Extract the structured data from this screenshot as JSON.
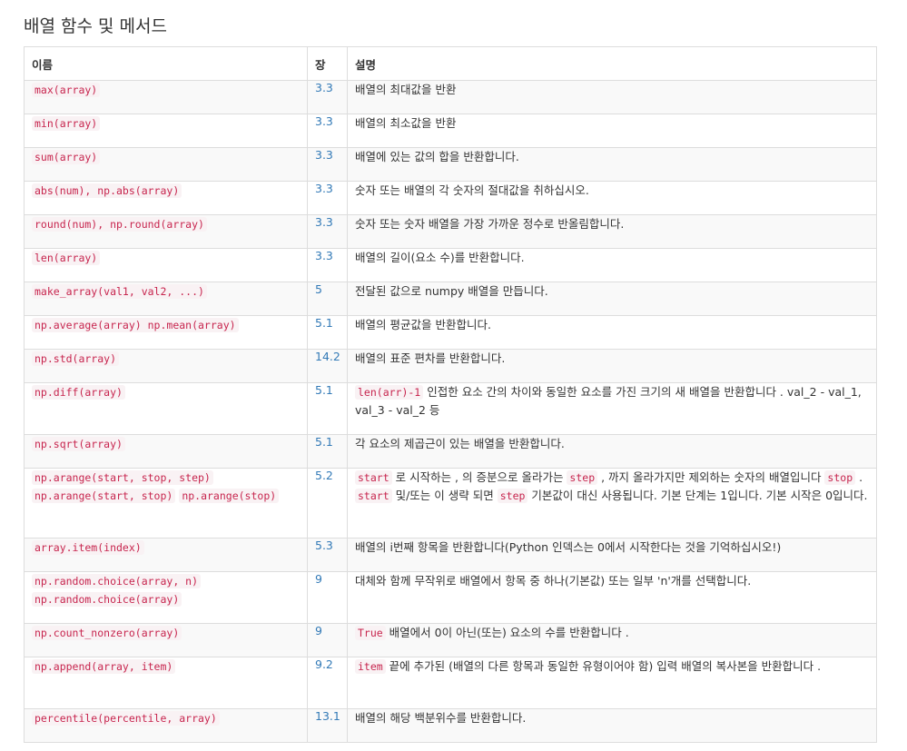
{
  "title": "배열 함수 및 메서드",
  "headers": {
    "name": "이름",
    "chapter": "장",
    "description": "설명"
  },
  "rows": [
    {
      "name": [
        "max(array)"
      ],
      "chapter": "3.3",
      "desc": [
        {
          "t": "배열의 최대값을 반환"
        }
      ]
    },
    {
      "name": [
        "min(array)"
      ],
      "chapter": "3.3",
      "desc": [
        {
          "t": "배열의 최소값을 반환"
        }
      ]
    },
    {
      "name": [
        "sum(array)"
      ],
      "chapter": "3.3",
      "desc": [
        {
          "t": "배열에 있는 값의 합을 반환합니다."
        }
      ]
    },
    {
      "name": [
        "abs(num), np.abs(array)"
      ],
      "chapter": "3.3",
      "desc": [
        {
          "t": "숫자 또는 배열의 각 숫자의 절대값을 취하십시오."
        }
      ]
    },
    {
      "name": [
        "round(num), np.round(array)"
      ],
      "chapter": "3.3",
      "desc": [
        {
          "t": "숫자 또는 숫자 배열을 가장 가까운 정수로 반올림합니다."
        }
      ]
    },
    {
      "name": [
        "len(array)"
      ],
      "chapter": "3.3",
      "desc": [
        {
          "t": "배열의 길이(요소 수)를 반환합니다."
        }
      ]
    },
    {
      "name": [
        "make_array(val1, val2, ...)"
      ],
      "chapter": "5",
      "desc": [
        {
          "t": "전달된 값으로 numpy 배열을 만듭니다."
        }
      ]
    },
    {
      "name": [
        "np.average(array) np.mean(array)"
      ],
      "chapter": "5.1",
      "desc": [
        {
          "t": "배열의 평균값을 반환합니다."
        }
      ]
    },
    {
      "name": [
        "np.std(array)"
      ],
      "chapter": "14.2",
      "desc": [
        {
          "t": "배열의 표준 편차를 반환합니다."
        }
      ]
    },
    {
      "name": [
        "np.diff(array)"
      ],
      "chapter": "5.1",
      "desc": [
        {
          "c": "len(arr)-1"
        },
        {
          "t": " 인접한 요소 간의 차이와 동일한 요소를 가진 크기의 새 배열을 반환합니다 . val_2 - val_1, val_3 - val_2 등"
        }
      ]
    },
    {
      "name": [
        "np.sqrt(array)"
      ],
      "chapter": "5.1",
      "desc": [
        {
          "t": "각 요소의 제곱근이 있는 배열을 반환합니다."
        }
      ]
    },
    {
      "name": [
        "np.arange(start, stop, step)",
        "np.arange(start, stop)",
        "np.arange(stop)"
      ],
      "chapter": "5.2",
      "desc": [
        {
          "c": "start"
        },
        {
          "t": " 로 시작하는 , 의 증분으로 올라가는 "
        },
        {
          "c": "step"
        },
        {
          "t": " , 까지 올라가지만 제외하는 숫자의 배열입니다 "
        },
        {
          "c": "stop"
        },
        {
          "t": " . "
        },
        {
          "c": "start"
        },
        {
          "t": " 및/또는 이 생략 되면 "
        },
        {
          "c": "step"
        },
        {
          "t": " 기본값이 대신 사용됩니다. 기본 단계는 1입니다. 기본 시작은 0입니다."
        }
      ]
    },
    {
      "name": [
        "array.item(index)"
      ],
      "chapter": "5.3",
      "desc": [
        {
          "t": "배열의 i번째 항목을 반환합니다(Python 인덱스는 0에서 시작한다는 것을 기억하십시오!)"
        }
      ]
    },
    {
      "name": [
        "np.random.choice(array, n)",
        "np.random.choice(array)"
      ],
      "chapter": "9",
      "desc": [
        {
          "t": "대체와 함께 무작위로 배열에서 항목 중 하나(기본값) 또는 일부 'n'개를 선택합니다."
        }
      ]
    },
    {
      "name": [
        "np.count_nonzero(array)"
      ],
      "chapter": "9",
      "desc": [
        {
          "c": "True"
        },
        {
          "t": " 배열에서 0이 아닌(또는) 요소의 수를 반환합니다 ."
        }
      ]
    },
    {
      "name": [
        "np.append(array, item)"
      ],
      "chapter": "9.2",
      "desc": [
        {
          "c": "item"
        },
        {
          "t": " 끝에 추가된 (배열의 다른 항목과 동일한 유형이어야 함) 입력 배열의 복사본을 반환합니다 ."
        }
      ]
    },
    {
      "name": [
        "percentile(percentile, array)"
      ],
      "chapter": "13.1",
      "desc": [
        {
          "t": "배열의 해당 백분위수를 반환합니다."
        }
      ]
    }
  ]
}
